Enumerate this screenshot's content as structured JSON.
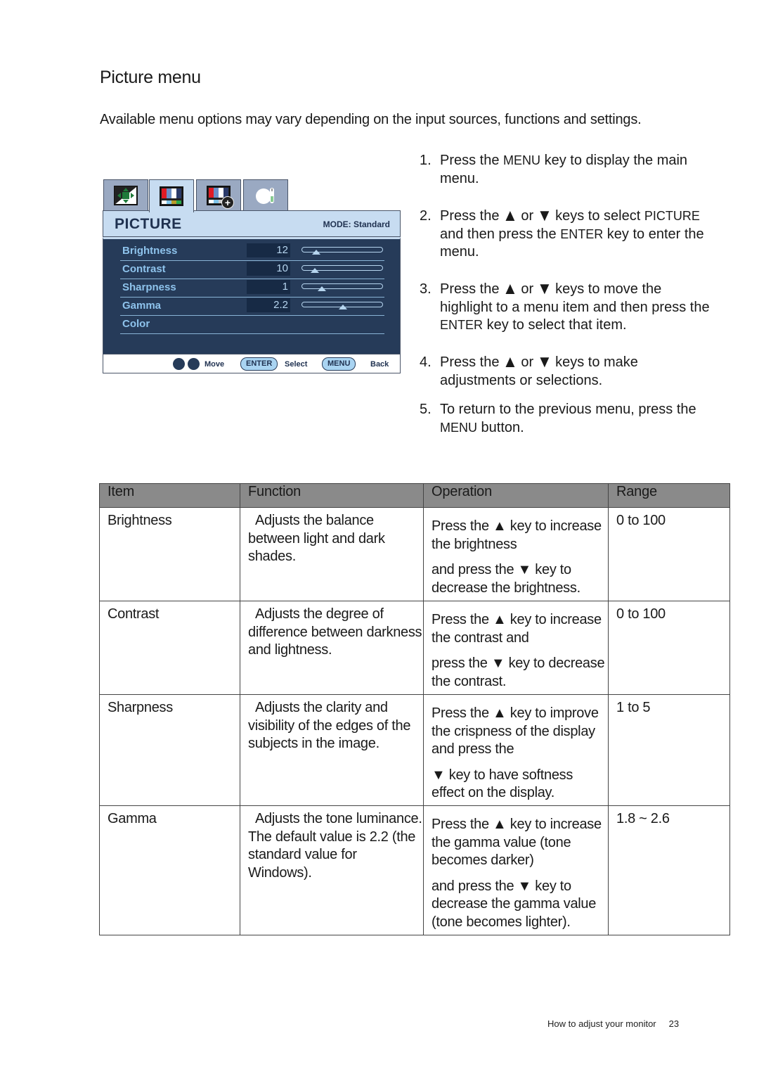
{
  "page": {
    "title": "Picture menu",
    "intro": "Available menu options may vary depending on the input sources, functions and settings.",
    "footer_section": "How to adjust your monitor",
    "page_number": "23"
  },
  "osd": {
    "tabs": [
      {
        "icon": "display-position-icon",
        "active": false
      },
      {
        "icon": "picture-icon",
        "active": true
      },
      {
        "icon": "picture-advanced-icon",
        "active": false
      },
      {
        "icon": "system-icon",
        "active": false
      }
    ],
    "header_title": "PICTURE",
    "mode_label": "MODE: Standard",
    "items": [
      {
        "label": "Brightness",
        "value": "12",
        "level": 0.12
      },
      {
        "label": "Contrast",
        "value": "10",
        "level": 0.1
      },
      {
        "label": "Sharpness",
        "value": "1",
        "level": 0.2
      },
      {
        "label": "Gamma",
        "value": "2.2",
        "level": 0.5
      },
      {
        "label": "Color",
        "value": null,
        "level": null
      }
    ],
    "footer": {
      "move_label": "Move",
      "enter_key": "ENTER",
      "select_label": "Select",
      "menu_key": "MENU",
      "back_label": "Back"
    },
    "colors": {
      "header_bg": "#c7dcf1",
      "body_bg": "#263b59",
      "label_color": "#8ec3ec"
    }
  },
  "steps": [
    {
      "num": "1.",
      "parts": [
        "Press the ",
        "MENU",
        " key to display the main menu."
      ]
    },
    {
      "num": "2.",
      "parts": [
        "Press the ",
        "▲",
        " or ",
        "▼",
        " keys to select ",
        "PICTURE",
        " and then press the ",
        "ENTER",
        " key to enter the menu."
      ]
    },
    {
      "num": "3.",
      "parts": [
        "Press the ",
        "▲",
        " or ",
        "▼",
        " keys to move the highlight to a menu item and then press the ",
        "ENTER",
        " key to select that item."
      ]
    },
    {
      "num": "4.",
      "parts": [
        "Press the ",
        "▲",
        " or ",
        "▼",
        " keys to make adjustments or selections."
      ]
    },
    {
      "num": "5.",
      "parts": [
        "To return to the previous menu, press the ",
        "MENU",
        " button."
      ]
    }
  ],
  "table": {
    "headers": [
      "Item",
      "Function",
      "Operation",
      "Range"
    ],
    "rows": [
      {
        "item": "Brightness",
        "function": "Adjusts the balance between light and dark shades.",
        "operation": [
          "Press the ▲ key to increase the brightness",
          "and press the ▼ key to decrease the brightness."
        ],
        "range": "0 to 100"
      },
      {
        "item": "Contrast",
        "function": "Adjusts the degree of difference between darkness and lightness.",
        "operation": [
          "Press the ▲ key to increase the contrast and",
          "press the ▼ key to decrease the contrast."
        ],
        "range": "0 to 100"
      },
      {
        "item": "Sharpness",
        "function": "Adjusts the clarity and visibility of the edges of the subjects in the image.",
        "operation": [
          "Press the ▲ key to improve the crispness of the display and press the",
          "▼ key to have softness effect on the display."
        ],
        "range": "1 to 5"
      },
      {
        "item": "Gamma",
        "function": "Adjusts the tone luminance. The default value is 2.2 (the standard value for Windows).",
        "operation": [
          "Press the ▲ key to increase the gamma value (tone becomes darker)",
          "and press the ▼ key to decrease the gamma value (tone becomes lighter)."
        ],
        "range": "1.8 ~ 2.6"
      }
    ]
  }
}
